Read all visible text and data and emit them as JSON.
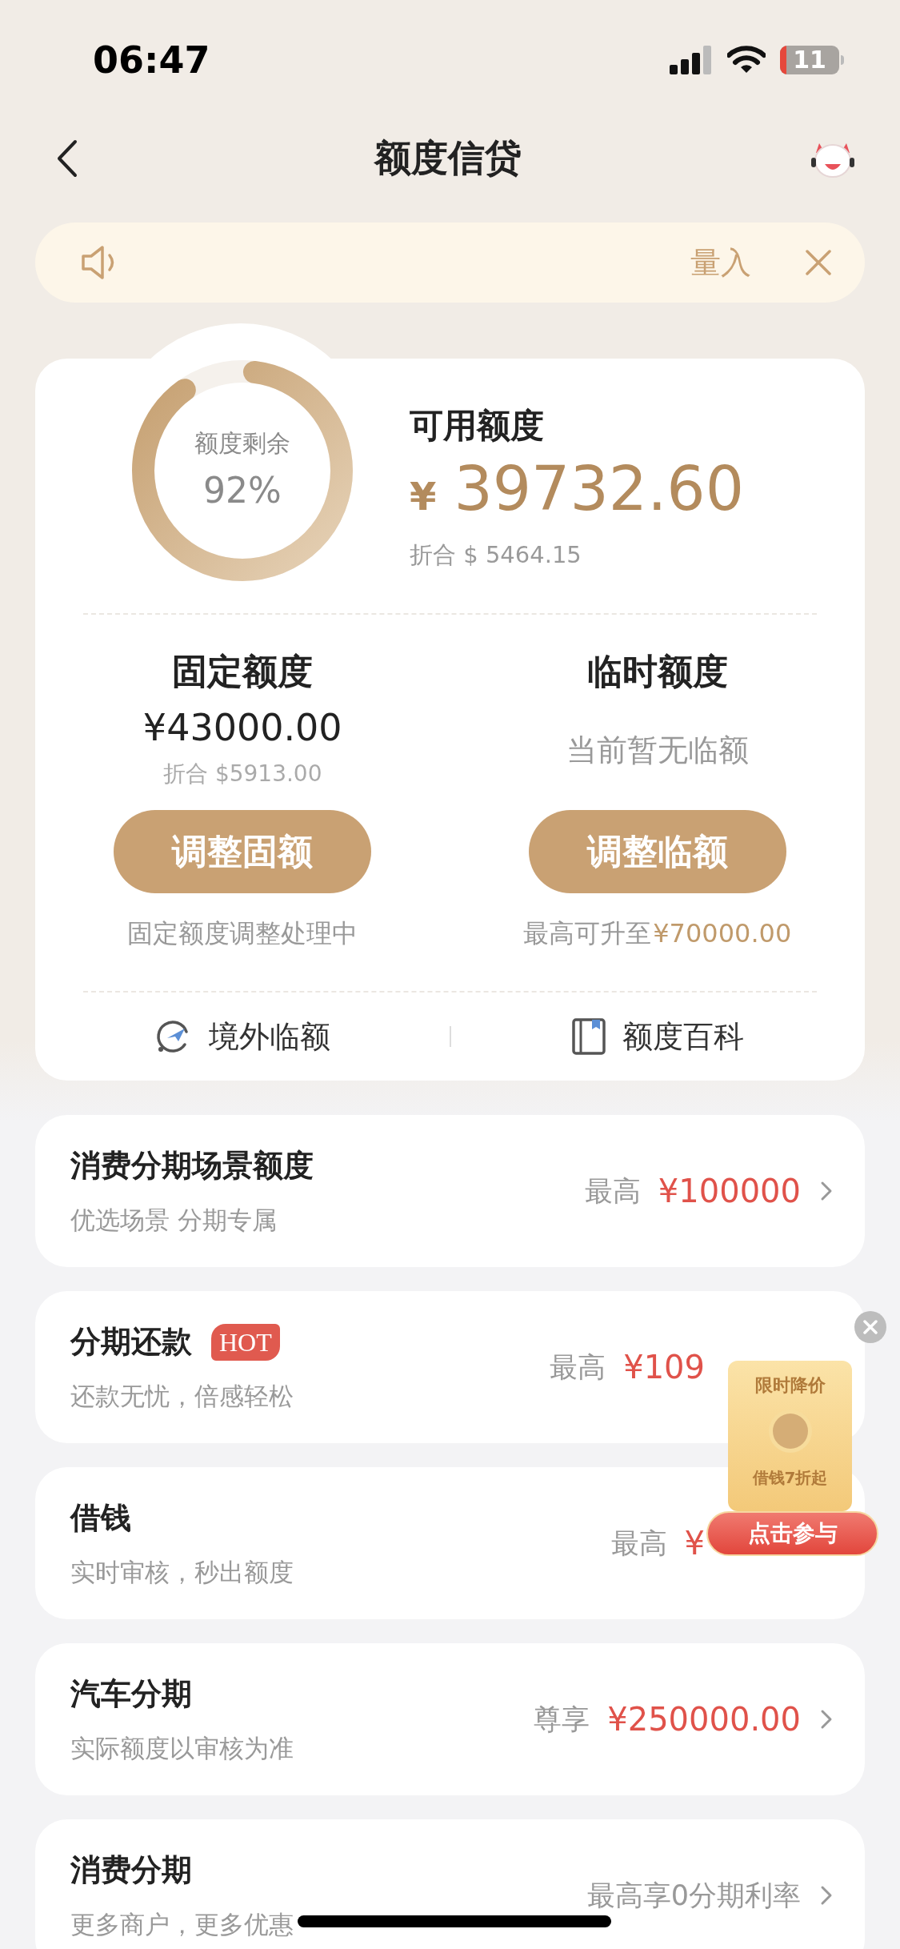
{
  "status_bar": {
    "time": "06:47",
    "battery": "11"
  },
  "nav": {
    "title": "额度信贷"
  },
  "notice": {
    "text": "量入"
  },
  "credit": {
    "ring_label": "额度剩余",
    "ring_value": "92%",
    "level": 0.92,
    "title": "可用额度",
    "currency": "¥",
    "amount": "39732.60",
    "converted": "折合 $ 5464.15"
  },
  "limits": [
    {
      "title": "固定额度",
      "amount": "¥43000.00",
      "converted": "折合 $5913.00",
      "button": "调整固额",
      "note": "固定额度调整处理中"
    },
    {
      "title": "临时额度",
      "status": "当前暂无临额",
      "button": "调整临额",
      "note": "最高可升至",
      "note_amount": "¥70000.00"
    }
  ],
  "links": [
    {
      "label": "境外临额",
      "kind": "overseas"
    },
    {
      "label": "额度百科",
      "kind": "book"
    }
  ],
  "products": [
    {
      "title": "消费分期场景额度",
      "subtitle": "优选场景 分期专属",
      "prefix": "最高",
      "value": "¥100000",
      "chevron": true
    },
    {
      "title": "分期还款",
      "badge": "HOT",
      "subtitle": "还款无忧，倍感轻松",
      "prefix": "最高",
      "value": "¥109",
      "chevron": false
    },
    {
      "title": "借钱",
      "subtitle": "实时审核，秒出额度",
      "prefix": "最高",
      "value": "¥",
      "chevron": false
    },
    {
      "title": "汽车分期",
      "subtitle": "实际额度以审核为准",
      "prefix": "尊享",
      "value": "¥250000.00",
      "chevron": true
    },
    {
      "title": "消费分期",
      "subtitle": "更多商户，更多优惠",
      "prefix": "最高享0分期利率",
      "chevron": true
    }
  ],
  "promo": {
    "title": "限时降价",
    "offer": "借钱**7折**起",
    "button": "点击参与"
  }
}
